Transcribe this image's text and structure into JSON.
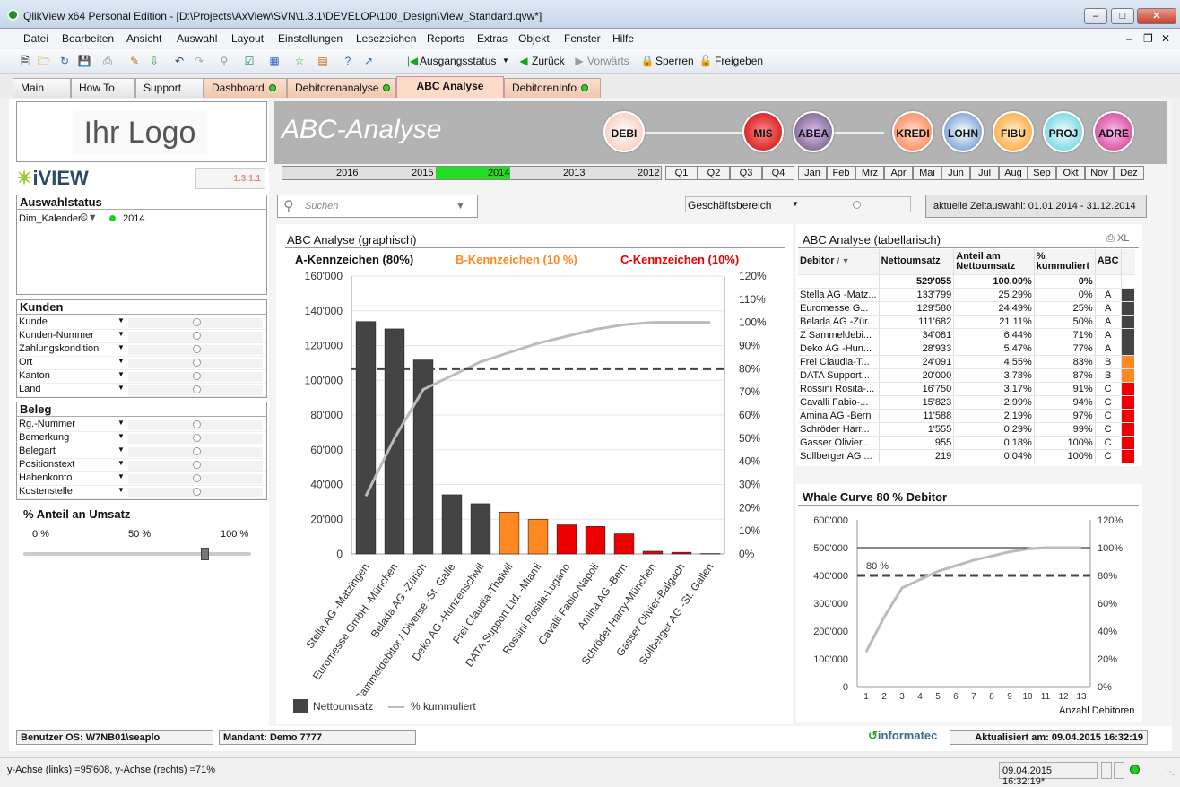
{
  "window": {
    "title": "QlikView x64 Personal Edition - [D:\\Projects\\AxView\\SVN\\1.3.1\\DEVELOP\\100_Design\\View_Standard.qvw*]"
  },
  "menu": [
    "Datei",
    "Bearbeiten",
    "Ansicht",
    "Auswahl",
    "Layout",
    "Einstellungen",
    "Lesezeichen",
    "Reports",
    "Extras",
    "Objekt",
    "Fenster",
    "Hilfe"
  ],
  "toolbar": {
    "ausgangsstatus": "Ausgangsstatus",
    "zurueck": "Zurück",
    "vorwaerts": "Vorwärts",
    "sperren": "Sperren",
    "freigeben": "Freigeben"
  },
  "tabs": [
    "Main",
    "How To",
    "Support",
    "Dashboard",
    "Debitorenanalyse",
    "ABC Analyse",
    "DebitorenInfo"
  ],
  "logo": {
    "text": "Ihr Logo",
    "brand": "iVIEW",
    "version": "1.3.1.1"
  },
  "auswahlstatus": {
    "title": "Auswahlstatus",
    "field": "Dim_Kalender",
    "value": "2014"
  },
  "kunden": {
    "title": "Kunden",
    "items": [
      "Kunde",
      "Kunden-Nummer",
      "Zahlungskondition",
      "Ort",
      "Kanton",
      "Land"
    ]
  },
  "beleg": {
    "title": "Beleg",
    "items": [
      "Rg.-Nummer",
      "Bemerkung",
      "Belegart",
      "Positionstext",
      "Habenkonto",
      "Kostenstelle"
    ]
  },
  "slider": {
    "title": "% Anteil an Umsatz",
    "labels": [
      "0 %",
      "50 %",
      "100 %"
    ],
    "value": 0.8
  },
  "banner": {
    "title": "ABC-Analyse",
    "buttons": [
      "DEBI",
      "MIS",
      "ABEA",
      "KREDI",
      "LOHN",
      "FIBU",
      "PROJ",
      "ADRE"
    ]
  },
  "years": [
    "2016",
    "2015",
    "2014",
    "2013",
    "2012"
  ],
  "quarters": [
    "Q1",
    "Q2",
    "Q3",
    "Q4"
  ],
  "months": [
    "Jan",
    "Feb",
    "Mrz",
    "Apr",
    "Mai",
    "Jun",
    "Jul",
    "Aug",
    "Sep",
    "Okt",
    "Nov",
    "Dez"
  ],
  "search": {
    "placeholder": "Suchen"
  },
  "geschaeftsbereich": "Geschäftsbereich",
  "zeitauswahl": "aktuelle Zeitauswahl: 01.01.2014 - 31.12.2014",
  "abc_graph": {
    "title": "ABC Analyse (graphisch)",
    "a_label": "A-Kennzeichen (80%)",
    "b_label": "B-Kennzeichen (10 %)",
    "c_label": "C-Kennzeichen (10%)",
    "legend_bar": "Nettoumsatz",
    "legend_line": "% kummuliert"
  },
  "abc_table": {
    "title": "ABC Analyse (tabellarisch)",
    "xl": "XL",
    "headers": [
      "Debitor",
      "Nettoumsatz",
      "Anteil am Nettoumsatz",
      "% kummuliert",
      "ABC"
    ],
    "total": [
      "",
      "529'055",
      "100.00%",
      "0%",
      ""
    ],
    "rows": [
      [
        "Stella AG -Matz...",
        "133'799",
        "25.29%",
        "0%",
        "A"
      ],
      [
        "Euromesse G...",
        "129'580",
        "24.49%",
        "25%",
        "A"
      ],
      [
        "Belada AG -Zür...",
        "111'682",
        "21.11%",
        "50%",
        "A"
      ],
      [
        "Z Sammeldebi...",
        "34'081",
        "6.44%",
        "71%",
        "A"
      ],
      [
        "Deko AG -Hun...",
        "28'933",
        "5.47%",
        "77%",
        "A"
      ],
      [
        "Frei Claudia-T...",
        "24'091",
        "4.55%",
        "83%",
        "B"
      ],
      [
        "DATA Support...",
        "20'000",
        "3.78%",
        "87%",
        "B"
      ],
      [
        "Rossini Rosita-...",
        "16'750",
        "3.17%",
        "91%",
        "C"
      ],
      [
        "Cavalli Fabio-...",
        "15'823",
        "2.99%",
        "94%",
        "C"
      ],
      [
        "Amina AG -Bern",
        "11'588",
        "2.19%",
        "97%",
        "C"
      ],
      [
        "Schröder Harr...",
        "1'555",
        "0.29%",
        "99%",
        "C"
      ],
      [
        "Gasser Olivier...",
        "955",
        "0.18%",
        "100%",
        "C"
      ],
      [
        "Sollberger AG ...",
        "219",
        "0.04%",
        "100%",
        "C"
      ]
    ]
  },
  "whale": {
    "title": "Whale Curve  80 % Debitor",
    "xlabel": "Anzahl Debitoren",
    "marker": "80 %"
  },
  "chart_data": [
    {
      "type": "bar",
      "title": "ABC Analyse (graphisch)",
      "categories": [
        "Stella AG -Matzingen",
        "Euromesse GmbH -München",
        "Belada AG -Zürich",
        "Z Sammeldebitor / Diverse -St. Galle",
        "Deko AG -Hunzenschwil",
        "Frei Claudia-Thalwil",
        "DATA Support Ltd. -Miami",
        "Rossini Rosita-Lugano",
        "Cavalli Fabio-Napoli",
        "Amina AG -Bern",
        "Schröder Harry-München",
        "Gasser Olivier-Balgach",
        "Sollberger AG -St. Gallen"
      ],
      "series": [
        {
          "name": "Nettoumsatz",
          "values": [
            133799,
            129580,
            111682,
            34081,
            28933,
            24091,
            20000,
            16750,
            15823,
            11588,
            1555,
            955,
            219
          ]
        },
        {
          "name": "% kummuliert",
          "values": [
            25,
            50,
            71,
            77,
            83,
            87,
            91,
            94,
            97,
            99,
            100,
            100,
            100
          ]
        }
      ],
      "bar_colors": [
        "#444444",
        "#444444",
        "#444444",
        "#444444",
        "#444444",
        "#ff8822",
        "#ff8822",
        "#ee0000",
        "#ee0000",
        "#ee0000",
        "#cc1111",
        "#cc1111",
        "#222222"
      ],
      "ylim": [
        0,
        160000
      ],
      "ylim_right": [
        0,
        120
      ],
      "yticks": [
        "0",
        "20'000",
        "40'000",
        "60'000",
        "80'000",
        "100'000",
        "120'000",
        "140'000",
        "160'000"
      ],
      "yticks_right": [
        "0%",
        "10%",
        "20%",
        "30%",
        "40%",
        "50%",
        "60%",
        "70%",
        "80%",
        "90%",
        "100%",
        "110%",
        "120%"
      ],
      "threshold_right": 80
    },
    {
      "type": "line",
      "title": "Whale Curve  80 % Debitor",
      "xlabel": "Anzahl Debitoren",
      "x": [
        1,
        2,
        3,
        4,
        5,
        6,
        7,
        8,
        9,
        10,
        11,
        12,
        13
      ],
      "values": [
        25,
        50,
        71,
        77,
        83,
        87,
        91,
        94,
        97,
        99,
        100,
        100,
        100
      ],
      "ylim": [
        0,
        600000
      ],
      "ylim_right": [
        0,
        120
      ],
      "yticks": [
        "0",
        "100'000",
        "200'000",
        "300'000",
        "400'000",
        "500'000",
        "600'000"
      ],
      "yticks_right": [
        "0%",
        "20%",
        "40%",
        "60%",
        "80%",
        "100%",
        "120%"
      ],
      "threshold_right": 80,
      "max_right": 100
    }
  ],
  "footer": {
    "benutzer": "Benutzer OS: W7NB01\\seaplo",
    "mandant": "Mandant: Demo 7777",
    "brand": "informatec",
    "aktualisiert": "Aktualisiert am: 09.04.2015 16:32:19"
  },
  "statusbar": {
    "left": "y-Achse (links) =95'608, y-Achse (rechts) =71%",
    "right": "09.04.2015 16:32:19*"
  },
  "colors": {
    "a": "#444444",
    "b": "#ff8822",
    "c": "#ee0000",
    "selected_year": "#22dd22"
  }
}
